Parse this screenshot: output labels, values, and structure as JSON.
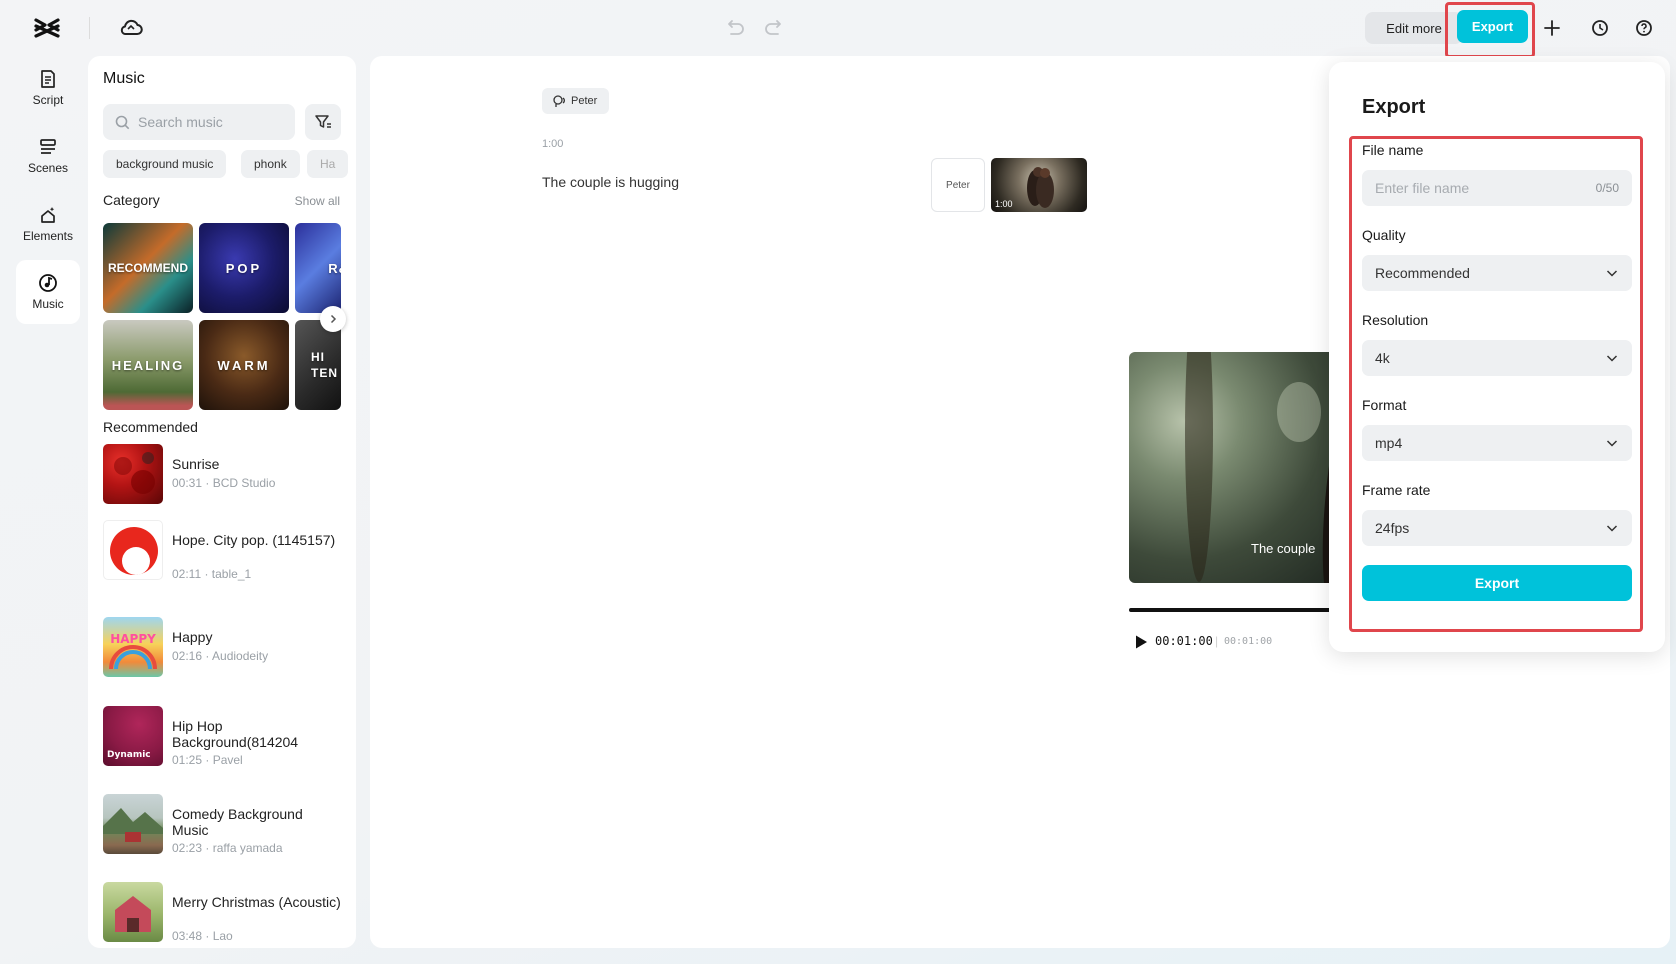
{
  "topbar": {
    "edit_more": "Edit more",
    "export": "Export"
  },
  "rail": [
    {
      "label": "Script",
      "icon": "script-icon"
    },
    {
      "label": "Scenes",
      "icon": "scenes-icon"
    },
    {
      "label": "Elements",
      "icon": "elements-icon"
    },
    {
      "label": "Music",
      "icon": "music-icon",
      "active": true
    }
  ],
  "music_panel": {
    "title": "Music",
    "search_placeholder": "Search music",
    "chips": [
      "background music",
      "phonk",
      "Ha"
    ],
    "category_label": "Category",
    "show_all": "Show all",
    "categories": [
      "RECOMMEND",
      "POP",
      "R&",
      "HEALING",
      "WARM",
      "HI TEN"
    ],
    "recommended_label": "Recommended",
    "tracks": [
      {
        "name": "Sunrise",
        "meta": "00:31 · BCD Studio"
      },
      {
        "name": "Hope. City pop. (1145157)",
        "meta": "02:11 · table_1"
      },
      {
        "name": "Happy",
        "meta": "02:16 · Audiodeity"
      },
      {
        "name": "Hip Hop Background(814204",
        "meta": "01:25 · Pavel"
      },
      {
        "name": "Comedy Background Music",
        "meta": "02:23 · raffa yamada"
      },
      {
        "name": "Merry Christmas (Acoustic)",
        "meta": "03:48 · Lao"
      }
    ],
    "thumb_texts": {
      "happy": "HAPPY",
      "dynamic": "Dynamic"
    }
  },
  "script": {
    "speaker": "Peter",
    "time": "1:00",
    "caption": "The couple is hugging",
    "card_speaker": "Peter",
    "clip_time": "1:00"
  },
  "preview": {
    "caption": "The couple",
    "current_time": "00:01:00",
    "separator": "|",
    "total_time": "00:01:00",
    "progress": 1.0
  },
  "export_dialog": {
    "title": "Export",
    "file_name_label": "File name",
    "file_name_placeholder": "Enter file name",
    "file_name_value": "",
    "file_name_count": "0/50",
    "quality_label": "Quality",
    "quality_value": "Recommended",
    "resolution_label": "Resolution",
    "resolution_value": "4k",
    "format_label": "Format",
    "format_value": "mp4",
    "frame_rate_label": "Frame rate",
    "frame_rate_value": "24fps",
    "export_button": "Export"
  },
  "colors": {
    "accent": "#00c2da",
    "highlight": "#e0464c"
  }
}
